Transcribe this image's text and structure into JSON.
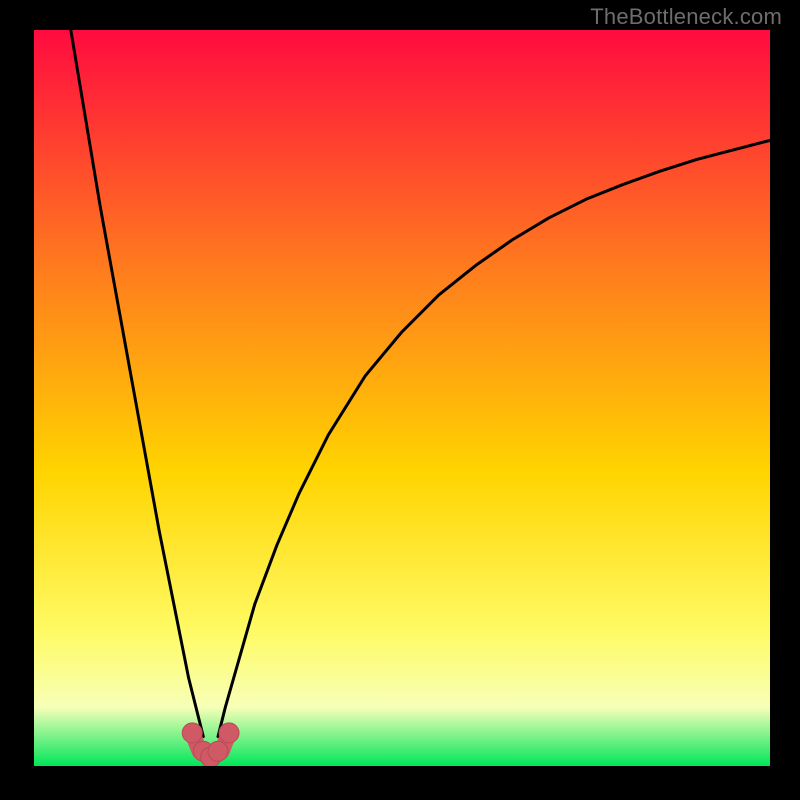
{
  "watermark": "TheBottleneck.com",
  "colors": {
    "gradient_top": "#ff0b3f",
    "gradient_upper_mid": "#ff7a1e",
    "gradient_mid": "#ffd400",
    "gradient_lower_mid": "#fffb66",
    "gradient_pale": "#f7ffb8",
    "gradient_bottom": "#00e65a",
    "curve": "#000000",
    "marker_fill": "#cf5a65",
    "marker_stroke": "#b94a55"
  },
  "chart_data": {
    "type": "line",
    "title": "",
    "xlabel": "",
    "ylabel": "",
    "xlim": [
      0,
      100
    ],
    "ylim": [
      0,
      100
    ],
    "x_optimum": 24,
    "series": [
      {
        "name": "left-branch",
        "x": [
          5,
          7,
          9,
          11,
          13,
          15,
          17,
          19,
          20,
          21,
          22,
          23
        ],
        "y": [
          100,
          88,
          76,
          65,
          54,
          43,
          32,
          22,
          17,
          12,
          8,
          4
        ]
      },
      {
        "name": "right-branch",
        "x": [
          25,
          26,
          28,
          30,
          33,
          36,
          40,
          45,
          50,
          55,
          60,
          65,
          70,
          75,
          80,
          85,
          90,
          95,
          100
        ],
        "y": [
          4,
          8,
          15,
          22,
          30,
          37,
          45,
          53,
          59,
          64,
          68,
          71.5,
          74.5,
          77,
          79,
          80.8,
          82.4,
          83.7,
          85
        ]
      }
    ],
    "markers": {
      "name": "optimum-cluster",
      "x": [
        21.5,
        23,
        24,
        25,
        26.5
      ],
      "y": [
        4.5,
        2.0,
        1.2,
        2.0,
        4.5
      ]
    },
    "connector": {
      "x": [
        21.5,
        22.5,
        24,
        25.5,
        26.5
      ],
      "y": [
        4.5,
        2.0,
        1.0,
        2.0,
        4.5
      ]
    },
    "gradient_stops": [
      {
        "offset": 0.0,
        "key": "gradient_top"
      },
      {
        "offset": 0.32,
        "key": "gradient_upper_mid"
      },
      {
        "offset": 0.6,
        "key": "gradient_mid"
      },
      {
        "offset": 0.82,
        "key": "gradient_lower_mid"
      },
      {
        "offset": 0.92,
        "key": "gradient_pale"
      },
      {
        "offset": 1.0,
        "key": "gradient_bottom"
      }
    ]
  }
}
